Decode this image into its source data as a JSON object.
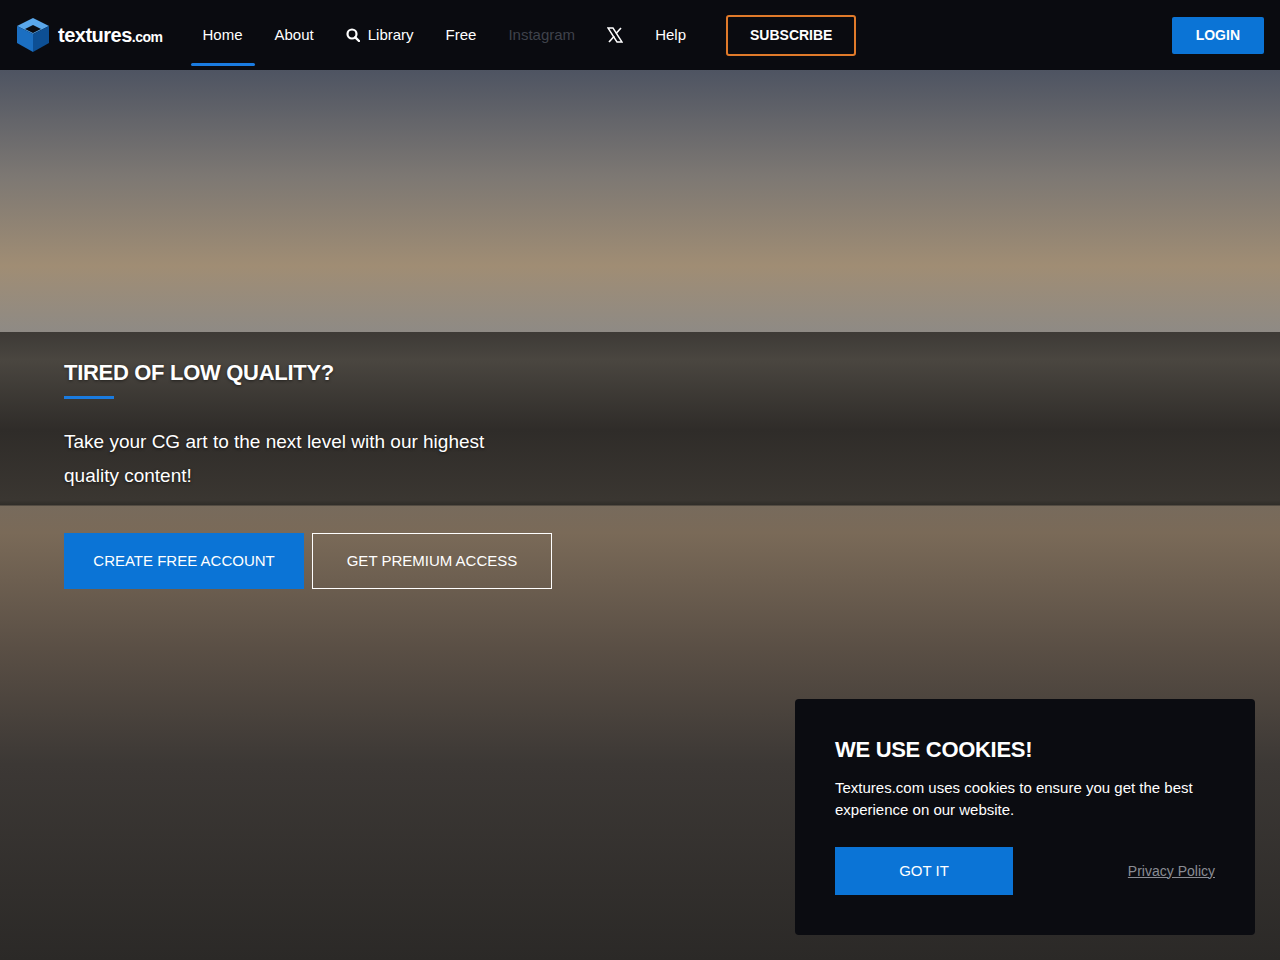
{
  "header": {
    "logo": {
      "name": "textures",
      "suffix": ".com"
    },
    "nav": [
      {
        "label": "Home",
        "kind": "text",
        "selected": true,
        "muted": false
      },
      {
        "label": "About",
        "kind": "text",
        "selected": false,
        "muted": false
      },
      {
        "label": "Library",
        "kind": "search",
        "selected": false,
        "muted": false
      },
      {
        "label": "Free",
        "kind": "text",
        "selected": false,
        "muted": false
      },
      {
        "label": "Instagram",
        "kind": "text",
        "selected": false,
        "muted": true
      },
      {
        "kind": "x",
        "selected": false,
        "muted": false
      },
      {
        "label": "Help",
        "kind": "text",
        "selected": false,
        "muted": false
      }
    ],
    "subscribe": "SUBSCRIBE",
    "login": "LOGIN"
  },
  "hero": {
    "title": "TIRED OF LOW QUALITY?",
    "text": "Take your CG art to the next level with our highest quality content!",
    "buttons": [
      {
        "label": "CREATE FREE ACCOUNT",
        "kind": "primary"
      },
      {
        "label": "GET PREMIUM ACCESS",
        "kind": "outline"
      }
    ]
  },
  "cookies": {
    "title": "WE USE COOKIES!",
    "text": "Textures.com uses cookies to ensure you get the best experience on our website.",
    "button": "GOT IT",
    "link": "Privacy Policy"
  }
}
